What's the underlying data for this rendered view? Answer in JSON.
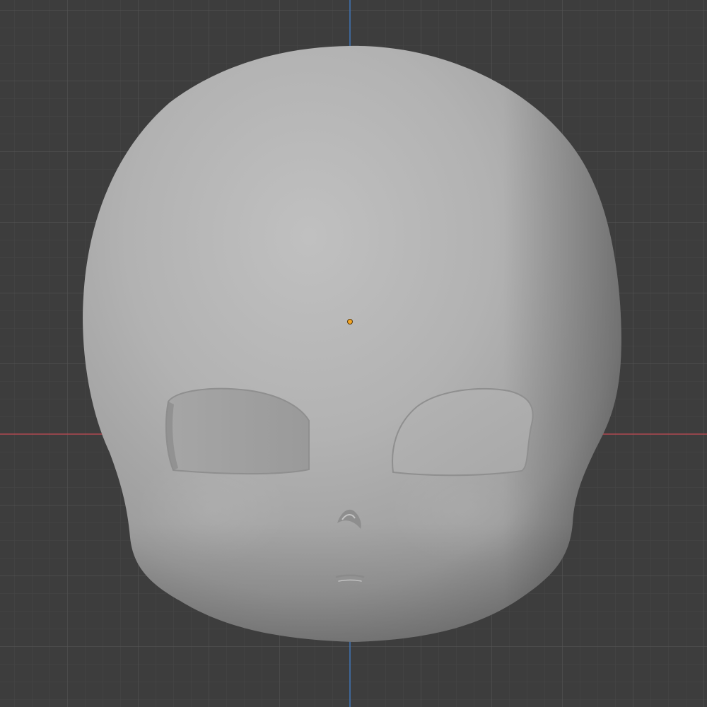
{
  "viewport": {
    "view": "front-orthographic",
    "background_color": "#3d3d3d",
    "grid_minor_color": "#474747",
    "grid_major_color": "#535353",
    "x_axis_color": "#b0484f",
    "z_axis_color": "#3f74b8",
    "object_origin_color": "#f5a623"
  },
  "object": {
    "type": "sculpted-head-mesh",
    "shading": "solid",
    "base_color": "#a9a9a9",
    "features": [
      "left-eye-socket",
      "right-eye-socket",
      "nose",
      "mouth"
    ]
  }
}
